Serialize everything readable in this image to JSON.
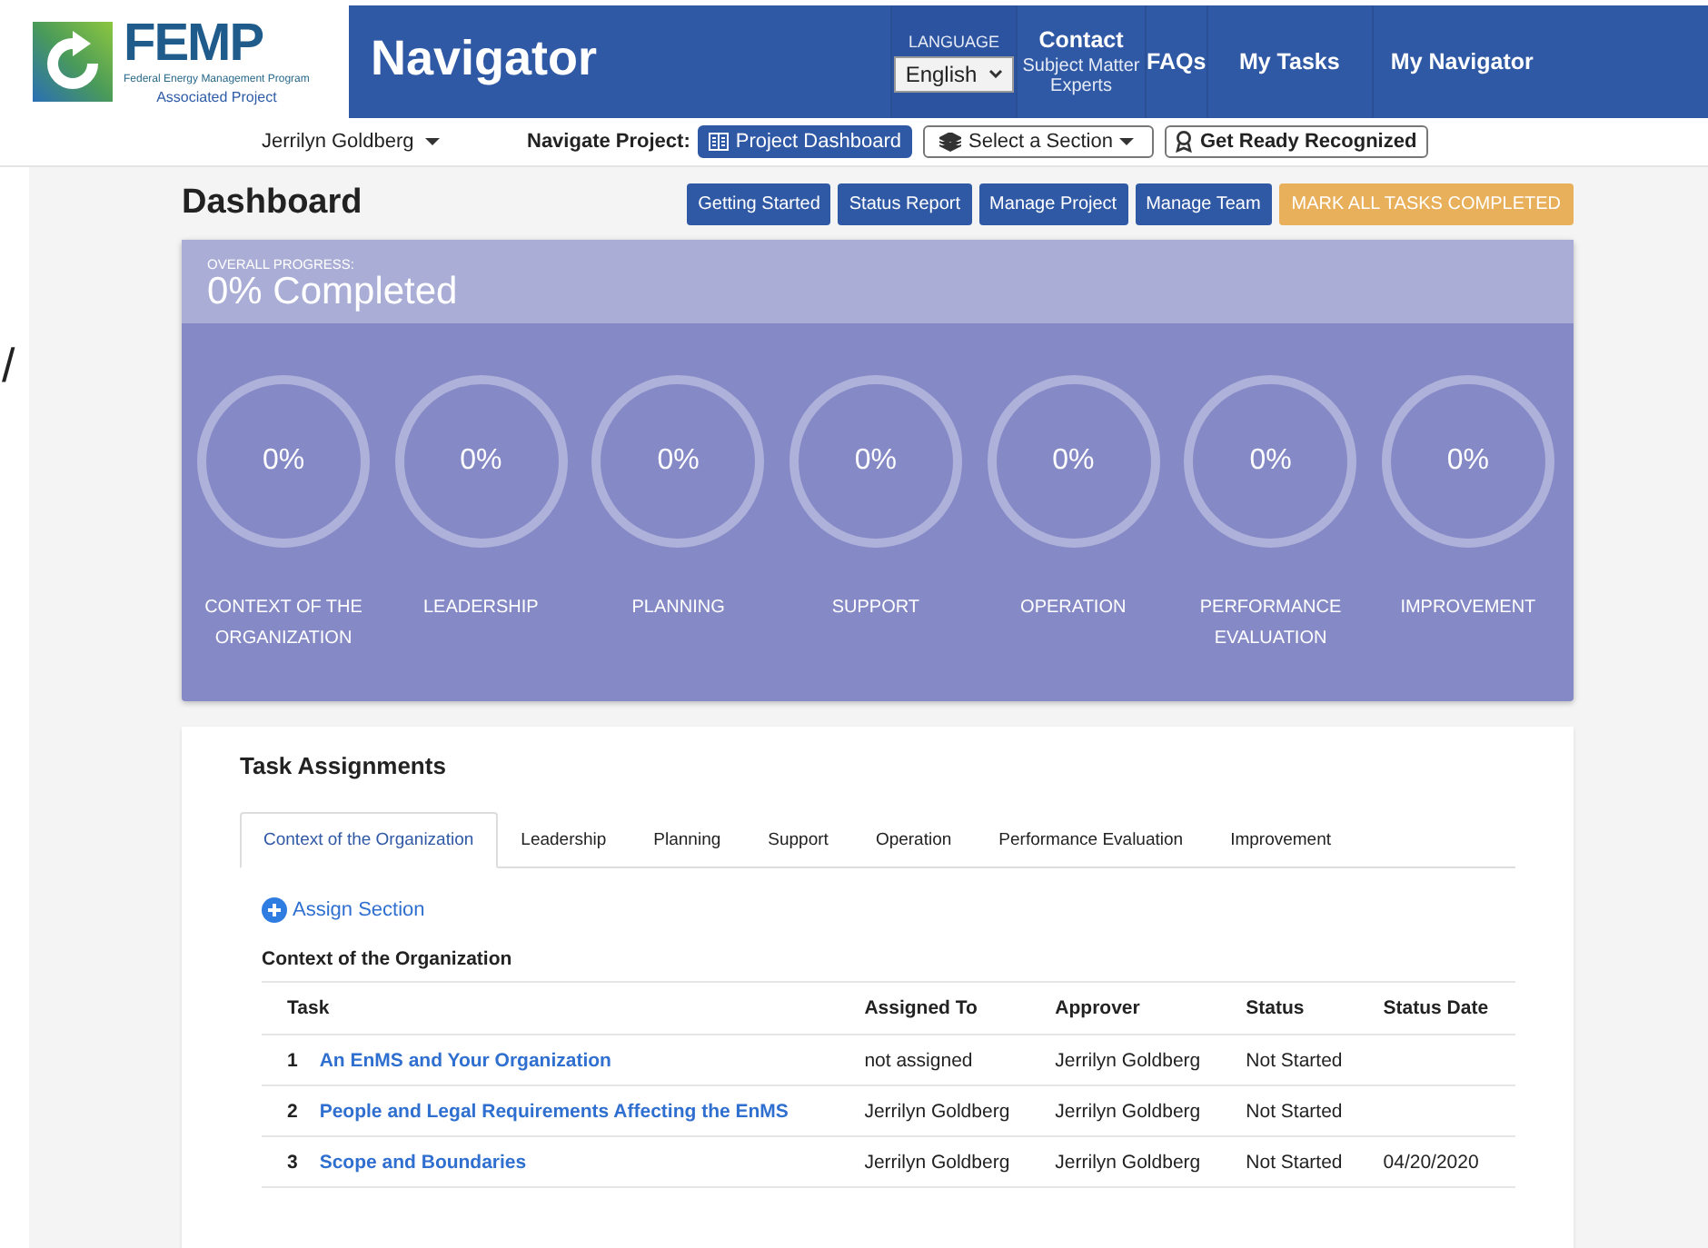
{
  "edge_text": "/",
  "logo": {
    "title": "FEMP",
    "subtitle": "Federal Energy Management Program",
    "caption": "Associated Project"
  },
  "app_title": "Navigator",
  "language": {
    "label": "LANGUAGE",
    "value": "English"
  },
  "nav": [
    {
      "title": "Contact",
      "subtitle": "Subject Matter Experts"
    },
    {
      "title": "FAQs"
    },
    {
      "title": "My Tasks"
    },
    {
      "title": "My Navigator"
    }
  ],
  "user_menu": "Jerrilyn Goldberg",
  "navigate_label": "Navigate Project:",
  "navigate_buttons": [
    {
      "label": "Project Dashboard",
      "kind": "primary"
    },
    {
      "label": "Select a Section",
      "kind": "dropdown"
    },
    {
      "label": "Get Ready Recognized",
      "kind": "award"
    }
  ],
  "page_title": "Dashboard",
  "actions": [
    {
      "label": "Getting Started",
      "kind": "primary"
    },
    {
      "label": "Status Report",
      "kind": "primary"
    },
    {
      "label": "Manage Project",
      "kind": "primary"
    },
    {
      "label": "Manage Team",
      "kind": "primary"
    },
    {
      "label": "MARK ALL TASKS COMPLETED",
      "kind": "warning"
    }
  ],
  "progress": {
    "label": "OVERALL PROGRESS:",
    "value": "0% Completed",
    "sections": [
      {
        "percent": "0%",
        "name": "CONTEXT OF THE ORGANIZATION"
      },
      {
        "percent": "0%",
        "name": "LEADERSHIP"
      },
      {
        "percent": "0%",
        "name": "PLANNING"
      },
      {
        "percent": "0%",
        "name": "SUPPORT"
      },
      {
        "percent": "0%",
        "name": "OPERATION"
      },
      {
        "percent": "0%",
        "name": "PERFORMANCE EVALUATION"
      },
      {
        "percent": "0%",
        "name": "IMPROVEMENT"
      }
    ]
  },
  "tasks": {
    "title": "Task Assignments",
    "tabs": [
      {
        "label": "Context of the Organization",
        "selected": true
      },
      {
        "label": "Leadership",
        "selected": false
      },
      {
        "label": "Planning",
        "selected": false
      },
      {
        "label": "Support",
        "selected": false
      },
      {
        "label": "Operation",
        "selected": false
      },
      {
        "label": "Performance Evaluation",
        "selected": false
      },
      {
        "label": "Improvement",
        "selected": false
      }
    ],
    "assign": "Assign Section",
    "section": "Context of the Organization",
    "columns": [
      "Task",
      "Assigned To",
      "Approver",
      "Status",
      "Status Date"
    ],
    "rows": [
      {
        "number": "1",
        "task": "An EnMS and Your Organization",
        "assigned_to": "not assigned",
        "approver": "Jerrilyn Goldberg",
        "status": "Not Started"
      },
      {
        "number": "2",
        "task": "People and Legal Requirements Affecting the EnMS",
        "assigned_to": "Jerrilyn Goldberg",
        "approver": "Jerrilyn Goldberg",
        "status": "Not Started"
      },
      {
        "number": "3",
        "task": "Scope and Boundaries",
        "assigned_to": "Jerrilyn Goldberg",
        "approver": "Jerrilyn Goldberg",
        "status": "Not Started",
        "status_date": "04/20/2020"
      }
    ]
  }
}
